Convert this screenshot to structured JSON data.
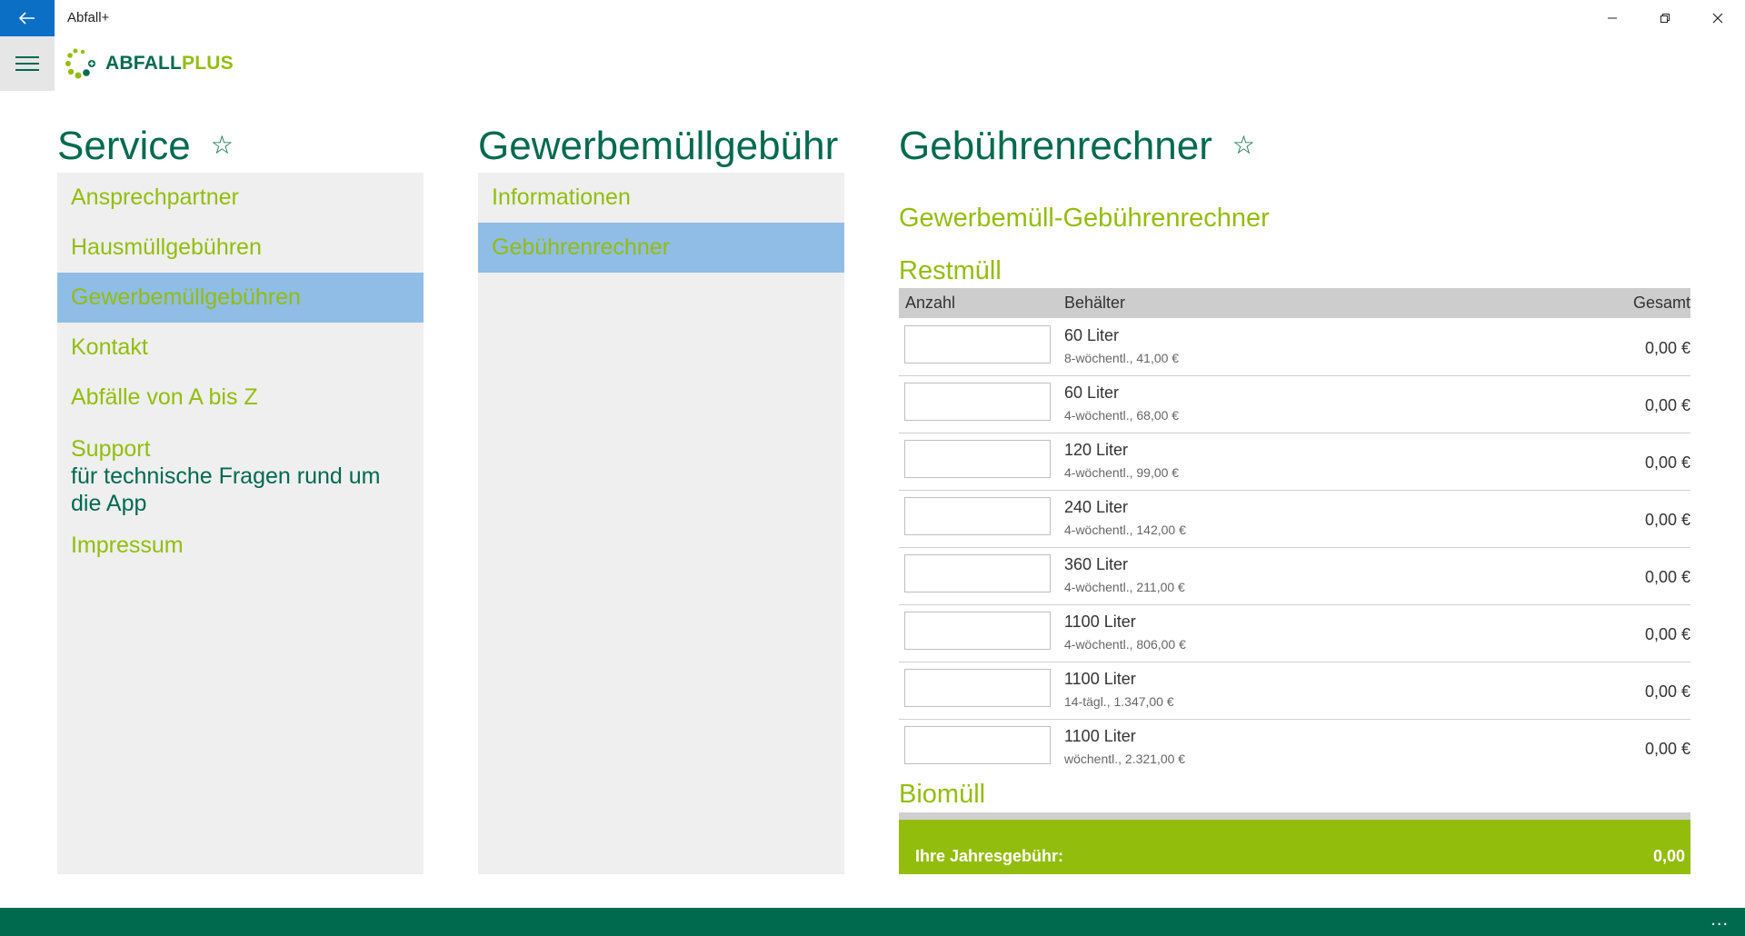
{
  "window": {
    "title": "Abfall+",
    "back_icon": "arrow-left-icon",
    "minimize_icon": "minimize-icon",
    "maximize_icon": "restore-icon",
    "close_icon": "close-icon"
  },
  "header": {
    "menu_icon": "hamburger-icon",
    "logo_part1": "ABFALL",
    "logo_part2": "PLUS"
  },
  "colors": {
    "dark_green": "#006a4e",
    "light_green": "#93bd0c",
    "selected_blue": "#8fbde6",
    "accent_blue": "#0b6fc6"
  },
  "service": {
    "title": "Service",
    "star_icon": "star-outline-icon",
    "items": [
      {
        "label": "Ansprechpartner"
      },
      {
        "label": "Hausmüllgebühren"
      },
      {
        "label": "Gewerbemüllgebühren",
        "selected": true
      },
      {
        "label": "Kontakt"
      },
      {
        "label": "Abfälle von A bis Z"
      }
    ],
    "support": {
      "label": "Support",
      "subtitle": "für technische Fragen rund um die App"
    },
    "impressum": "Impressum"
  },
  "gewerbe": {
    "title": "Gewerbemüllgebühr",
    "items": [
      {
        "label": "Informationen"
      },
      {
        "label": "Gebührenrechner",
        "selected": true
      }
    ]
  },
  "calculator": {
    "title": "Gebührenrechner",
    "star_icon": "star-outline-icon",
    "subtitle": "Gewerbemüll-Gebührenrechner",
    "restmuell": {
      "heading": "Restmüll",
      "columns": {
        "count": "Anzahl",
        "container": "Behälter",
        "total": "Gesamt"
      },
      "rows": [
        {
          "volume": "60 Liter",
          "frequency": "8-wöchentl., 41,00 €",
          "count": "",
          "total": "0,00 €"
        },
        {
          "volume": "60 Liter",
          "frequency": "4-wöchentl., 68,00 €",
          "count": "",
          "total": "0,00 €"
        },
        {
          "volume": "120 Liter",
          "frequency": "4-wöchentl., 99,00 €",
          "count": "",
          "total": "0,00 €"
        },
        {
          "volume": "240 Liter",
          "frequency": "4-wöchentl., 142,00 €",
          "count": "",
          "total": "0,00 €"
        },
        {
          "volume": "360 Liter",
          "frequency": "4-wöchentl., 211,00 €",
          "count": "",
          "total": "0,00 €"
        },
        {
          "volume": "1100 Liter",
          "frequency": "4-wöchentl., 806,00 €",
          "count": "",
          "total": "0,00 €"
        },
        {
          "volume": "1100 Liter",
          "frequency": "14-tägl., 1.347,00 €",
          "count": "",
          "total": "0,00 €"
        },
        {
          "volume": "1100 Liter",
          "frequency": "wöchentl., 2.321,00 €",
          "count": "",
          "total": "0,00 €"
        }
      ]
    },
    "biomuell": {
      "heading": "Biomüll"
    },
    "summary": {
      "label": "Ihre Jahresgebühr:",
      "value": "0,00"
    }
  },
  "appbar": {
    "more_label": "..."
  }
}
